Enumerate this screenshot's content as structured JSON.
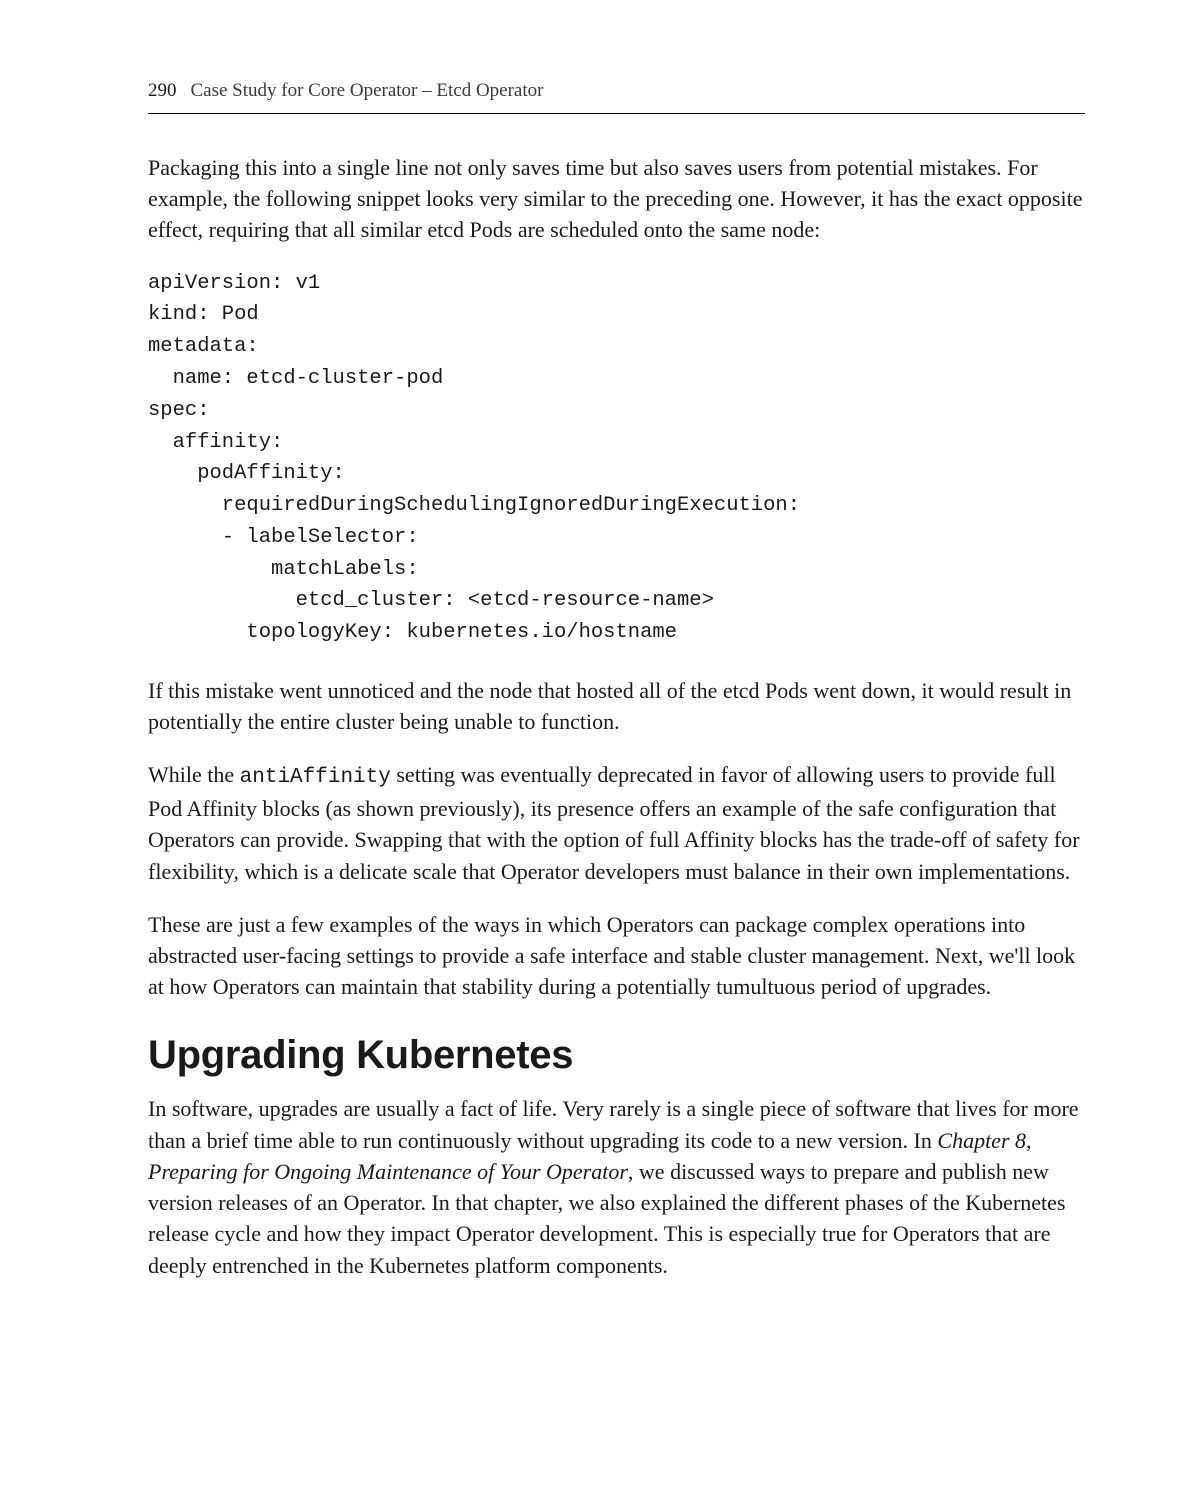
{
  "header": {
    "page_number": "290",
    "chapter_title": "Case Study for Core Operator – Etcd Operator"
  },
  "paragraphs": {
    "intro": "Packaging this into a single line not only saves time but also saves users from potential mistakes. For example, the following snippet looks very similar to the preceding one. However, it has the exact opposite effect, requiring that all similar etcd Pods are scheduled onto the same node:",
    "after_code": "If this mistake went unnoticed and the node that hosted all of the etcd Pods went down, it would result in potentially the entire cluster being unable to function.",
    "anti_affinity_pre": "While the ",
    "anti_affinity_code": "antiAffinity",
    "anti_affinity_post": " setting was eventually deprecated in favor of allowing users to provide full Pod Affinity blocks (as shown previously), its presence offers an example of the safe configuration that Operators can provide. Swapping that with the option of full Affinity blocks has the trade-off of safety for flexibility, which is a delicate scale that Operator developers must balance in their own implementations.",
    "examples": "These are just a few examples of the ways in which Operators can package complex operations into abstracted user-facing settings to provide a safe interface and stable cluster management. Next, we'll look at how Operators can maintain that stability during a potentially tumultuous period of upgrades.",
    "upgrading_pre": "In software, upgrades are usually a fact of life. Very rarely is a single piece of software that lives for more than a brief time able to run continuously without upgrading its code to a new version. In ",
    "upgrading_chapter_ref": "Chapter 8",
    "upgrading_comma": ", ",
    "upgrading_chapter_title": "Preparing for Ongoing Maintenance of Your Operator",
    "upgrading_post": ", we discussed ways to prepare and publish new version releases of an Operator. In that chapter, we also explained the different phases of the Kubernetes release cycle and how they impact Operator development. This is especially true for Operators that are deeply entrenched in the Kubernetes platform components."
  },
  "code": "apiVersion: v1\nkind: Pod\nmetadata:\n  name: etcd-cluster-pod\nspec:\n  affinity:\n    podAffinity:\n      requiredDuringSchedulingIgnoredDuringExecution:\n      - labelSelector:\n          matchLabels:\n            etcd_cluster: <etcd-resource-name>\n        topologyKey: kubernetes.io/hostname",
  "section_heading": "Upgrading Kubernetes"
}
